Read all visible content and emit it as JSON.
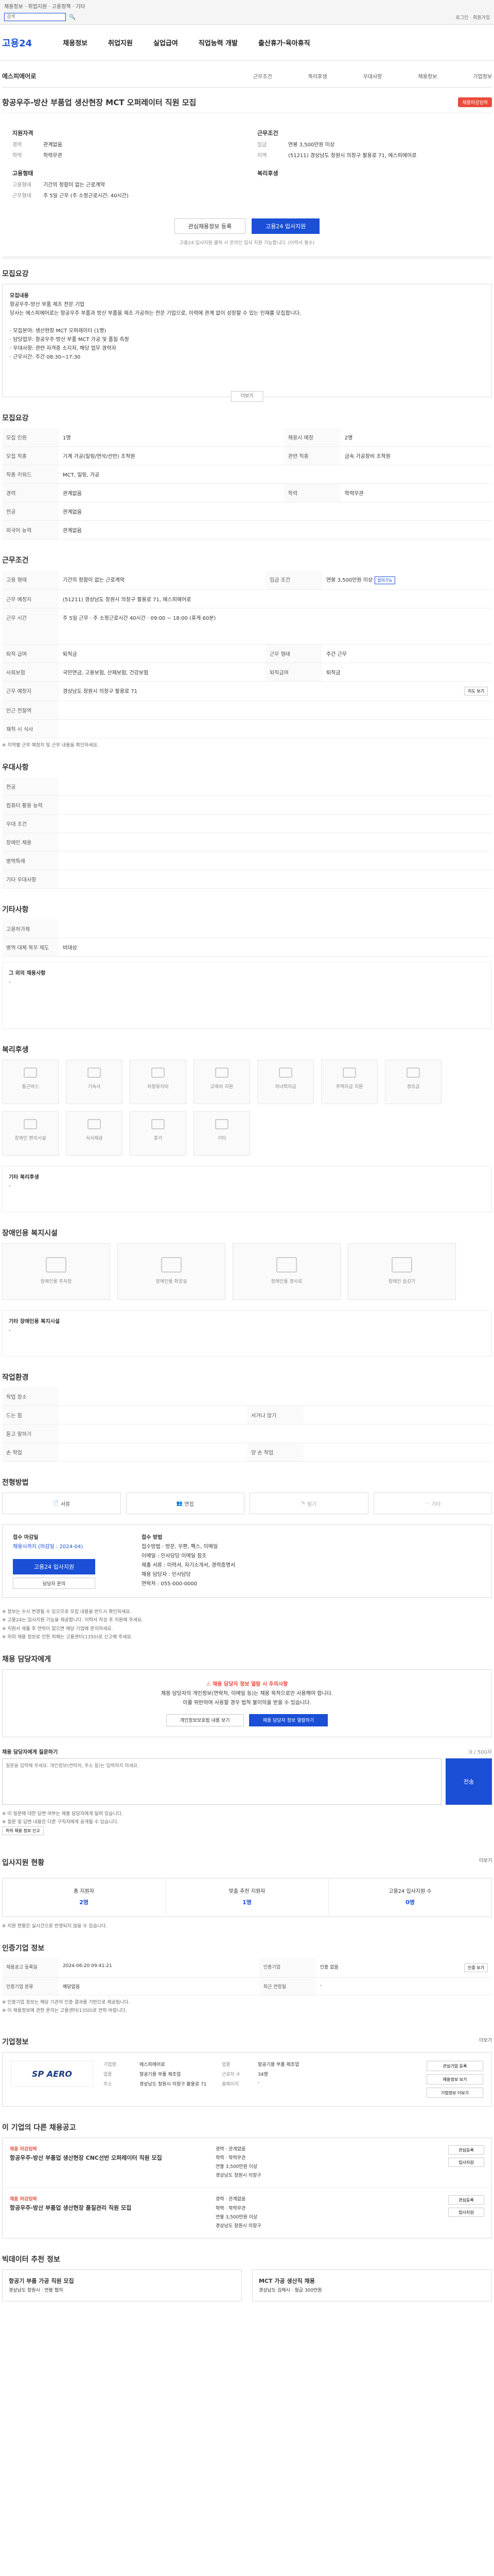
{
  "topbar": {
    "service_links": "채용정보 · 취업지원 · 고용정책 · 기타",
    "search_placeholder": "검색",
    "search_button": "검색",
    "utils": "로그인 · 회원가입"
  },
  "header": {
    "logo": "고용24",
    "gnb": [
      "채용정보",
      "취업지원",
      "실업급여",
      "직업능력 개발",
      "출산휴가·육아휴직"
    ]
  },
  "subnav": {
    "company": "에스피에어로",
    "links": [
      "근무조건",
      "복리후생",
      "우대사항",
      "채용정보",
      "기업정보"
    ]
  },
  "job": {
    "title": "항공우주-방산 부품업 생산현장 MCT 오퍼레이터 직원 모집",
    "badge": "채용마감임박",
    "left_group_label": "지원자격",
    "left": [
      {
        "k": "경력",
        "v": "관계없음"
      },
      {
        "k": "학력",
        "v": "학력무관"
      }
    ],
    "right_group_label": "근무조건",
    "right": [
      {
        "k": "임금",
        "v": "연봉 3,500만원 이상"
      },
      {
        "k": "지역",
        "v": "(51211) 경상남도 창원시 의창구 팔용로 71, 에스피에어로"
      }
    ],
    "type_label": "고용형태",
    "types": [
      {
        "k": "고용형태",
        "v": "기간의 정함이 없는 근로계약"
      },
      {
        "k": "근무형태",
        "v": "주 5일 근무 (주 소정근로시간: 40시간)"
      }
    ],
    "benefit_label": "복리후생",
    "buttons": {
      "scrap": "관심채용정보 등록",
      "apply": "고용24 입사지원"
    },
    "note": "고용24 입사지원 클릭 시 온라인 입사 지원 가능합니다. (이력서 필수)"
  },
  "summary": {
    "title": "모집요강",
    "lines": [
      "모집내용",
      "항공우주-방산 부품 제조 전문 기업",
      "당사는 에스피에어로는 항공우주 부품과 방산 부품을 제조 가공하는 전문 기업으로, 이력에 관계 없이 성장할 수 있는 인재를 모집합니다.",
      "· 모집분야: 생산현장 MCT 오퍼레이터 (1명)",
      "· 담당업무: 항공우주·방산 부품 MCT 가공 및 품질 측정",
      "· 우대사항: 관련 자격증 소지자, 해당 업무 경력자",
      "· 근무시간: 주간 08:30~17:30"
    ],
    "more": "더보기"
  },
  "recruit": {
    "title": "모집요강",
    "rows": [
      {
        "k": "모집 인원",
        "v": "1명",
        "k2": "채용시 예정",
        "v2": "2명"
      },
      {
        "k": "모집 직종",
        "v": "기계 가공(밀링/연삭/선반) 조작원",
        "k2": "관련 직종",
        "v2": "금속 가공장비 조작원"
      },
      {
        "k": "직종 키워드",
        "v": "MCT, 밀링, 가공",
        "k2": "",
        "v2": ""
      },
      {
        "k": "경력",
        "v": "관계없음",
        "k2": "학력",
        "v2": "학력무관"
      },
      {
        "k": "전공",
        "v": "관계없음",
        "k2": "",
        "v2": ""
      },
      {
        "k": "외국어 능력",
        "v": "관계없음",
        "k2": "",
        "v2": ""
      }
    ]
  },
  "conditions": {
    "title": "근무조건",
    "rows": [
      {
        "k": "고용 형태",
        "v": "기간의 정함이 없는 근로계약",
        "k2": "임금 조건",
        "v2": "연봉 3,500만원 이상",
        "tag": "협의가능"
      },
      {
        "k": "근무 예정지",
        "v": "(51211) 경상남도 창원시 의창구 팔용로 71, 에스피에어로",
        "k2": "",
        "v2": ""
      },
      {
        "k": "근무 시간",
        "v": "주 5일 근무 · 주 소정근로시간 40시간 · 09:00 ~ 18:00 (휴게 60분)",
        "k2": "",
        "v2": ""
      },
      {
        "k": "퇴직 급여",
        "v": "퇴직금",
        "k2": "근무 형태",
        "v2": "주간 근무"
      },
      {
        "k": "사회보험",
        "v": "국민연금, 고용보험, 산재보험, 건강보험",
        "k2": "퇴직급여",
        "v2": "퇴직금"
      },
      {
        "k": "근무 예정지",
        "v": "경상남도 창원시 의창구 팔용로 71",
        "k2": "",
        "v2": "",
        "btn": "지도 보기"
      },
      {
        "k": "인근 전철역",
        "v": "",
        "k2": "",
        "v2": ""
      },
      {
        "k": "재직 시 식사",
        "v": "",
        "k2": "",
        "v2": ""
      }
    ],
    "footnote": "※ 지역별 근무 예정지 및 근무 내용을 확인하세요."
  },
  "preference": {
    "title": "우대사항",
    "rows": [
      {
        "k": "전공",
        "v": ""
      },
      {
        "k": "컴퓨터 활용 능력",
        "v": ""
      },
      {
        "k": "우대 조건",
        "v": ""
      },
      {
        "k": "장애인 채용",
        "v": ""
      },
      {
        "k": "병역특례",
        "v": ""
      },
      {
        "k": "기타 우대사항",
        "v": ""
      }
    ]
  },
  "other": {
    "title": "기타사항",
    "rows": [
      {
        "k": "고용허가제",
        "v": ""
      },
      {
        "k": "병역 대체 복무 제도",
        "v": "비대상"
      },
      {
        "k": "그 외의 채용사항",
        "v": "-"
      }
    ]
  },
  "welfare": {
    "title": "복리후생",
    "items": [
      "통근버스",
      "기숙사",
      "차량유지비",
      "교육비 지원",
      "자녀학자금",
      "주택자금 지원",
      "경조금",
      "장애인 편의시설",
      "식사제공",
      "휴가",
      "기타"
    ],
    "other_label": "기타 복리후생",
    "other_value": "-"
  },
  "disability": {
    "title": "장애인용 복지시설",
    "items": [
      "장애인용 주차장",
      "장애인용 화장실",
      "장애인용 경사로",
      "장애인 승강기",
      "기타"
    ],
    "other_label": "기타 장애인용 복지시설",
    "other_value": "-"
  },
  "workenv": {
    "title": "작업환경",
    "rows": [
      {
        "k": "작업 장소",
        "v": "",
        "k2": "",
        "v2": ""
      },
      {
        "k": "드는 힘",
        "v": "",
        "k2": "서거나 앉기",
        "v2": ""
      },
      {
        "k": "듣고 말하기",
        "v": "",
        "k2": "",
        "v2": ""
      },
      {
        "k": "손 작업",
        "v": "",
        "k2": "양 손 작업",
        "v2": ""
      }
    ]
  },
  "process": {
    "title": "전형방법",
    "steps": [
      "서류",
      "면접",
      "필기",
      "기타"
    ],
    "apply_label": "접수 마감일",
    "apply_value": "채용시까지 (마감일 : 2024-04)",
    "apply_btn": "고용24 입사지원",
    "apply_btn2": "담당자 문의",
    "method_label": "접수 방법",
    "methods": [
      "접수방법 · 방문, 우편, 팩스, 이메일",
      "이메일 : 인사담당 이메일 참조",
      "제출 서류 : 이력서, 자기소개서, 경력증명서",
      "채용 담당자 : 인사담당",
      "연락처 : 055-000-0000"
    ],
    "bullets": [
      "※ 정보는 수시 변경될 수 있으므로 모집 내용을 반드시 확인하세요.",
      "※ 고용24는 입사지원 기능을 제공합니다. 이력서 작성 후 지원해 주세요.",
      "※ 지원서 제출 후 연락이 없으면 해당 기업에 문의하세요.",
      "※ 허위 채용 정보로 인한 피해는 고용센터(1350)로 신고해 주세요."
    ]
  },
  "qa": {
    "title": "채용 담당자에게",
    "warn": "채용 담당자 정보 열람 시 주의사항",
    "msg1": "채용 담당자의 개인정보(연락처, 이메일 등)는 채용 목적으로만 사용해야 합니다.",
    "msg2": "이를 위반하여 사용할 경우 법적 불이익을 받을 수 있습니다.",
    "btn1": "개인정보보호법 내용 보기",
    "btn2": "채용 담당자 정보 열람하기",
    "ask_label": "채용 담당자에게 질문하기",
    "ask_counter": "0 / 500자",
    "ask_placeholder": "질문을 입력해 주세요. 개인정보(연락처, 주소 등)는 입력하지 마세요.",
    "ask_btn": "전송",
    "notes": [
      "※ 이 질문에 대한 답변 여부는 채용 담당자에게 달려 있습니다.",
      "※ 질문 및 답변 내용은 다른 구직자에게 공개될 수 있습니다."
    ],
    "report_btn": "허위 채용 정보 신고"
  },
  "stats": {
    "title": "입사지원 현황",
    "more": "더보기",
    "items": [
      {
        "label": "총 지원자",
        "value": "2명"
      },
      {
        "label": "맞춤 추천 지원자",
        "value": "1명"
      },
      {
        "label": "고용24 입사지원 수",
        "value": "0명"
      }
    ],
    "note": "※ 지원 현황은 실시간으로 반영되지 않을 수 있습니다."
  },
  "info": {
    "title": "인증기업 정보",
    "rows": [
      {
        "k": "채용공고 등록일",
        "v": "2024-06-20 09:41:21",
        "k2": "인증기업",
        "v2": "인증 없음",
        "btn": "인증 보기"
      },
      {
        "k": "인증기업 분류",
        "v": "해당없음",
        "k2": "최근 연장일",
        "v2": "-"
      }
    ],
    "bullets": [
      "※ 인증기업 정보는 해당 기관의 인증 결과를 기반으로 제공됩니다.",
      "※ 이 채용정보에 관한 문의는 고용센터(1350)로 연락 바랍니다."
    ]
  },
  "company": {
    "title": "기업정보",
    "more": "더보기",
    "logo": "SP AERO",
    "rows": [
      {
        "k": "기업명",
        "v": "에스피에어로",
        "k2": "업종",
        "v2": "항공기용 부품 제조업"
      },
      {
        "k": "업종",
        "v": "항공기용 부품 제조업",
        "k2": "근로자 수",
        "v2": "34명"
      },
      {
        "k": "주소",
        "v": "경상남도 창원시 의창구 팔용로 71",
        "k2": "홈페이지",
        "v2": "-"
      }
    ],
    "btns": [
      "관심기업 등록",
      "채용정보 보기",
      "기업정보 더보기"
    ]
  },
  "other_jobs": {
    "title": "이 기업의 다른 채용공고",
    "items": [
      {
        "new": "채용 마감임박",
        "title": "항공우주-방산 부품업 생산현장 CNC선반 오퍼레이터 직원 모집",
        "m1": "경력 · 관계없음",
        "m2": "학력 · 학력무관",
        "m3": "연봉 3,500만원 이상",
        "m4": "경상남도 창원시 의창구",
        "b1": "관심등록",
        "b2": "입사지원"
      },
      {
        "new": "채용 마감임박",
        "title": "항공우주-방산 부품업 생산현장 품질관리 직원 모집",
        "m1": "경력 · 관계없음",
        "m2": "학력 · 학력무관",
        "m3": "연봉 3,500만원 이상",
        "m4": "경상남도 창원시 의창구",
        "b1": "관심등록",
        "b2": "입사지원"
      }
    ]
  },
  "recommend": {
    "title": "빅데이터 추천 정보",
    "items": [
      {
        "title": "항공기 부품 가공 직원 모집",
        "desc": "경상남도 창원시 · 연봉 협의"
      },
      {
        "title": "MCT 가공 생산직 채용",
        "desc": "경상남도 김해시 · 월급 300만원"
      }
    ]
  }
}
